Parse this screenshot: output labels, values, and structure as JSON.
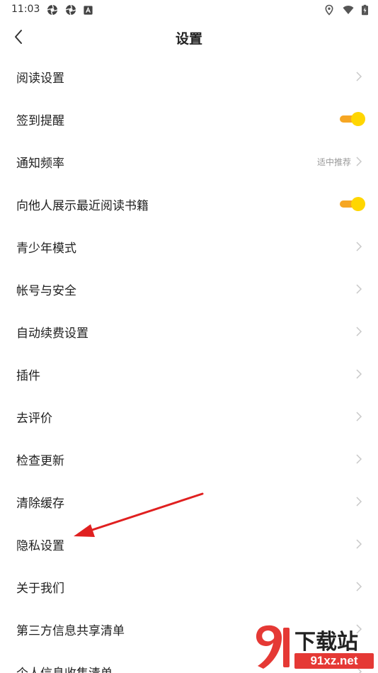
{
  "status_bar": {
    "time": "11:03",
    "left_icons": [
      "aperture-icon",
      "aperture-icon",
      "a-box-icon"
    ],
    "right_icons": [
      "location-icon",
      "wifi-icon",
      "battery-charging-icon"
    ]
  },
  "header": {
    "title": "设置",
    "back_icon": "chevron-left-icon"
  },
  "settings": {
    "items": [
      {
        "label": "阅读设置",
        "control": "chevron"
      },
      {
        "label": "签到提醒",
        "control": "toggle",
        "on": true
      },
      {
        "label": "通知频率",
        "control": "chevron",
        "value": "适中推荐"
      },
      {
        "label": "向他人展示最近阅读书籍",
        "control": "toggle",
        "on": true
      },
      {
        "label": "青少年模式",
        "control": "chevron"
      },
      {
        "label": "帐号与安全",
        "control": "chevron"
      },
      {
        "label": "自动续费设置",
        "control": "chevron"
      },
      {
        "label": "插件",
        "control": "chevron"
      },
      {
        "label": "去评价",
        "control": "chevron"
      },
      {
        "label": "检查更新",
        "control": "chevron"
      },
      {
        "label": "清除缓存",
        "control": "chevron"
      },
      {
        "label": "隐私设置",
        "control": "chevron"
      },
      {
        "label": "关于我们",
        "control": "chevron"
      },
      {
        "label": "第三方信息共享清单",
        "control": "chevron"
      },
      {
        "label": "个人信息收集清单",
        "control": "chevron"
      }
    ]
  },
  "colors": {
    "toggle_track": "#f6a623",
    "toggle_knob": "#ffd600",
    "annotation_arrow": "#e02020",
    "chevron": "#c8c8c8",
    "secondary_text": "#999999"
  },
  "watermark": {
    "text": "下载站",
    "domain": "91xz.net"
  }
}
